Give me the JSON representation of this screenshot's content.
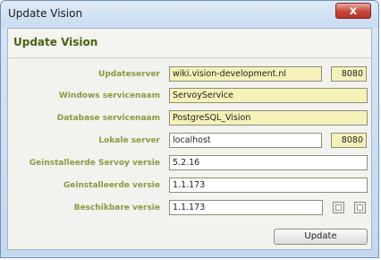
{
  "window": {
    "title": "Update Vision",
    "close_symbol": "x"
  },
  "panel": {
    "title": "Update Vision"
  },
  "fields": {
    "updateserver": {
      "label": "Updateserver",
      "value": "wiki.vision-development.nl",
      "port": "8080"
    },
    "windows_service": {
      "label": "Windows servicenaam",
      "value": "ServoyService"
    },
    "database_service": {
      "label": "Database servicenaam",
      "value": "PostgreSQL_Vision"
    },
    "local_server": {
      "label": "Lokale server",
      "value": "localhost",
      "port": "8080"
    },
    "servoy_version": {
      "label": "Geinstalleerde Servoy versie",
      "value": "5.2.16"
    },
    "installed_version": {
      "label": "Geinstalleerde versie",
      "value": "1.1.173"
    },
    "available_version": {
      "label": "Beschikbare versie",
      "value": "1.1.173"
    }
  },
  "buttons": {
    "update": "Update"
  },
  "colors": {
    "label": "#8a9a3e",
    "title": "#4a6212",
    "highlight_field": "#f4f2b8"
  }
}
